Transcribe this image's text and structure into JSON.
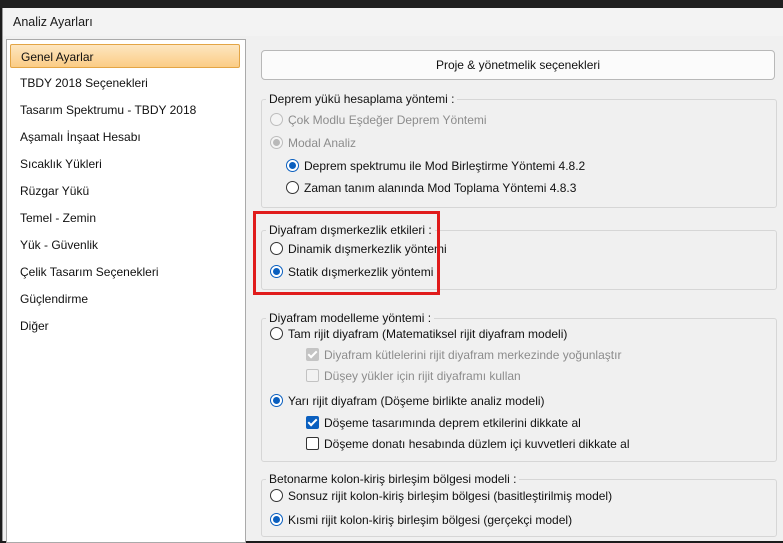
{
  "window": {
    "title": "Analiz Ayarları"
  },
  "nav": {
    "items": [
      {
        "label": "Genel Ayarlar",
        "selected": true
      },
      {
        "label": "TBDY 2018 Seçenekleri"
      },
      {
        "label": "Tasarım Spektrumu - TBDY 2018"
      },
      {
        "label": "Aşamalı İnşaat Hesabı"
      },
      {
        "label": "Sıcaklık Yükleri"
      },
      {
        "label": "Rüzgar Yükü"
      },
      {
        "label": "Temel - Zemin"
      },
      {
        "label": "Yük - Güvenlik"
      },
      {
        "label": "Çelik Tasarım Seçenekleri"
      },
      {
        "label": "Güçlendirme"
      },
      {
        "label": "Diğer"
      }
    ]
  },
  "main": {
    "project_button": "Proje & yönetmelik seçenekleri",
    "earthquake": {
      "title": "Deprem yükü hesaplama yöntemi :",
      "option1": "Çok Modlu Eşdeğer Deprem Yöntemi",
      "option2": "Modal Analiz",
      "sub1": "Deprem spektrumu ile Mod Birleştirme Yöntemi 4.8.2",
      "sub2": "Zaman tanım alanında Mod Toplama Yöntemi 4.8.3"
    },
    "eccentricity": {
      "title": "Diyafram dışmerkezlik etkileri :",
      "option1": "Dinamik dışmerkezlik yöntemi",
      "option2": "Statik dışmerkezlik yöntemi"
    },
    "diaphragm": {
      "title": "Diyafram modelleme yöntemi :",
      "option1": "Tam rijit diyafram (Matematiksel rijit diyafram modeli)",
      "option1_chk1": "Diyafram kütlelerini rijit diyafram merkezinde yoğunlaştır",
      "option1_chk2": "Düşey yükler için rijit diyaframı kullan",
      "option2": "Yarı rijit diyafram (Döşeme birlikte analiz modeli)",
      "option2_chk1": "Döşeme tasarımında deprem etkilerini dikkate al",
      "option2_chk2": "Döşeme donatı hesabında düzlem içi kuvvetleri dikkate al"
    },
    "joint": {
      "title": "Betonarme kolon-kiriş birleşim bölgesi modeli :",
      "option1": "Sonsuz rijit kolon-kiriş birleşim bölgesi (basitleştirilmiş model)",
      "option2": "Kısmi rijit kolon-kiriş birleşim bölgesi (gerçekçi model)"
    }
  },
  "colors": {
    "selection_bg": "#fbd08c",
    "accent": "#0a5fbf",
    "highlight_box": "#e01b1b"
  }
}
